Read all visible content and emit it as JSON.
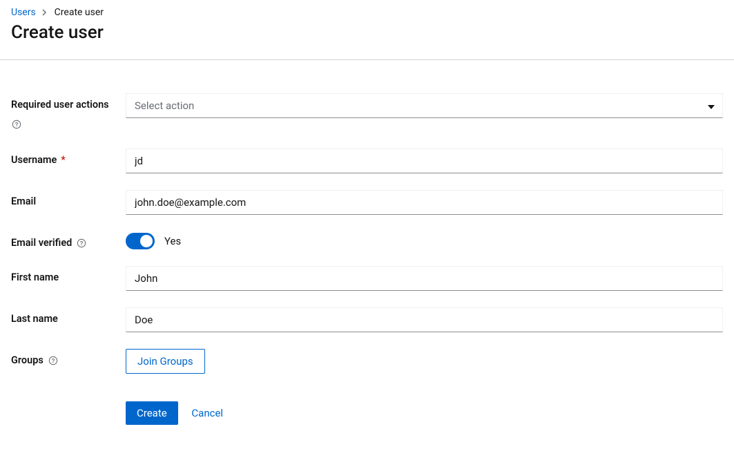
{
  "breadcrumb": {
    "parent": "Users",
    "current": "Create user"
  },
  "page": {
    "title": "Create user"
  },
  "form": {
    "required_actions_label": "Required user actions",
    "required_actions_placeholder": "Select action",
    "username_label": "Username",
    "username_value": "jd",
    "email_label": "Email",
    "email_value": "john.doe@example.com",
    "email_verified_label": "Email verified",
    "email_verified_state": "Yes",
    "firstname_label": "First name",
    "firstname_value": "John",
    "lastname_label": "Last name",
    "lastname_value": "Doe",
    "groups_label": "Groups",
    "join_groups_btn": "Join Groups"
  },
  "actions": {
    "create": "Create",
    "cancel": "Cancel"
  }
}
